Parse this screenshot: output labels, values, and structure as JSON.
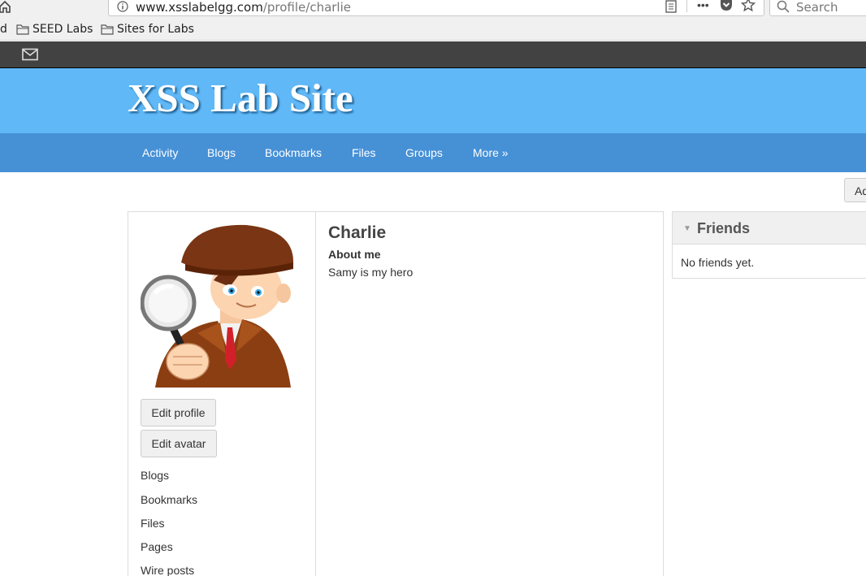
{
  "browser": {
    "url_host": "www.xsslabelgg.com",
    "url_path": "/profile/charlie",
    "search_placeholder": "Search",
    "bookmark_partial": "d",
    "bookmarks": [
      {
        "label": "SEED Labs",
        "icon": "folder-icon"
      },
      {
        "label": "Sites for Labs",
        "icon": "folder-icon"
      }
    ]
  },
  "topbar": {
    "icon": "mail-icon"
  },
  "header": {
    "site_title": "XSS Lab Site",
    "color": "#60b8f7"
  },
  "nav": {
    "color": "#4690d6",
    "items": [
      {
        "label": "Activity"
      },
      {
        "label": "Blogs"
      },
      {
        "label": "Bookmarks"
      },
      {
        "label": "Files"
      },
      {
        "label": "Groups"
      },
      {
        "label": "More »"
      }
    ]
  },
  "add_button": {
    "label": "Ad"
  },
  "profile": {
    "name": "Charlie",
    "about_label": "About me",
    "about_value": "Samy is my hero",
    "buttons": {
      "edit_profile": "Edit profile",
      "edit_avatar": "Edit avatar"
    },
    "links": [
      {
        "label": "Blogs"
      },
      {
        "label": "Bookmarks"
      },
      {
        "label": "Files"
      },
      {
        "label": "Pages"
      },
      {
        "label": "Wire posts"
      }
    ]
  },
  "friends": {
    "title": "Friends",
    "empty_text": "No friends yet."
  }
}
